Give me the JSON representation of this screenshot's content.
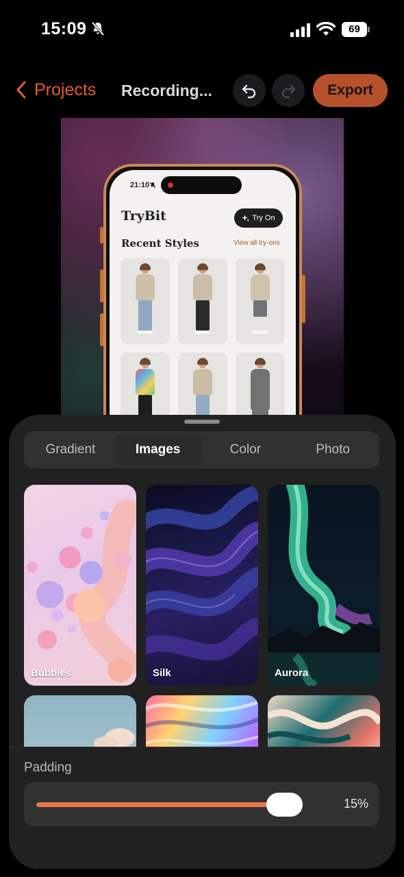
{
  "status_bar": {
    "time": "15:09",
    "battery": "69",
    "icons": [
      "bell-slash-icon",
      "cellular-signal-icon",
      "wifi-icon",
      "battery-icon"
    ]
  },
  "nav": {
    "back_label": "Projects",
    "title": "Recording...",
    "export_label": "Export",
    "accent_color": "#E25F2E"
  },
  "preview": {
    "phone_time": "21:10",
    "brand": "TryBit",
    "try_on_label": "Try On",
    "section_title": "Recent Styles",
    "view_all_label": "View all try-ons"
  },
  "sheet": {
    "tabs": [
      {
        "label": "Gradient",
        "active": false
      },
      {
        "label": "Images",
        "active": true
      },
      {
        "label": "Color",
        "active": false
      },
      {
        "label": "Photo",
        "active": false
      }
    ],
    "backgrounds": [
      {
        "label": "Bubbles"
      },
      {
        "label": "Silk"
      },
      {
        "label": "Aurora"
      },
      {
        "label": ""
      },
      {
        "label": ""
      },
      {
        "label": ""
      }
    ],
    "padding": {
      "label": "Padding",
      "value_text": "15%",
      "value": 0.15,
      "slider_fill_color": "#E8764A"
    }
  }
}
